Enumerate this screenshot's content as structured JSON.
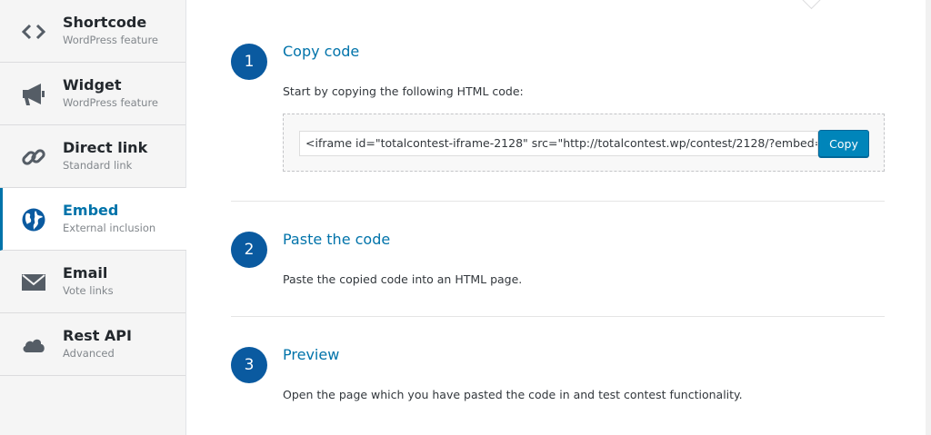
{
  "sidebar": {
    "items": [
      {
        "title": "Shortcode",
        "subtitle": "WordPress feature",
        "icon": "code-brackets-icon"
      },
      {
        "title": "Widget",
        "subtitle": "WordPress feature",
        "icon": "megaphone-icon"
      },
      {
        "title": "Direct link",
        "subtitle": "Standard link",
        "icon": "link-icon"
      },
      {
        "title": "Embed",
        "subtitle": "External inclusion",
        "icon": "globe-icon",
        "active": true
      },
      {
        "title": "Email",
        "subtitle": "Vote links",
        "icon": "envelope-icon"
      },
      {
        "title": "Rest API",
        "subtitle": "Advanced",
        "icon": "cloud-icon"
      }
    ]
  },
  "steps": [
    {
      "number": "1",
      "title": "Copy code",
      "description": "Start by copying the following HTML code:"
    },
    {
      "number": "2",
      "title": "Paste the code",
      "description": "Paste the copied code into an HTML page."
    },
    {
      "number": "3",
      "title": "Preview",
      "description": "Open the page which you have pasted the code in and test contest functionality."
    }
  ],
  "embed": {
    "code": "<iframe id=\"totalcontest-iframe-2128\" src=\"http://totalcontest.wp/contest/2128/?embed=",
    "copy_label": "Copy"
  },
  "colors": {
    "accent": "#0073aa",
    "step_circle": "#0a5aa0",
    "button": "#0085ba"
  }
}
